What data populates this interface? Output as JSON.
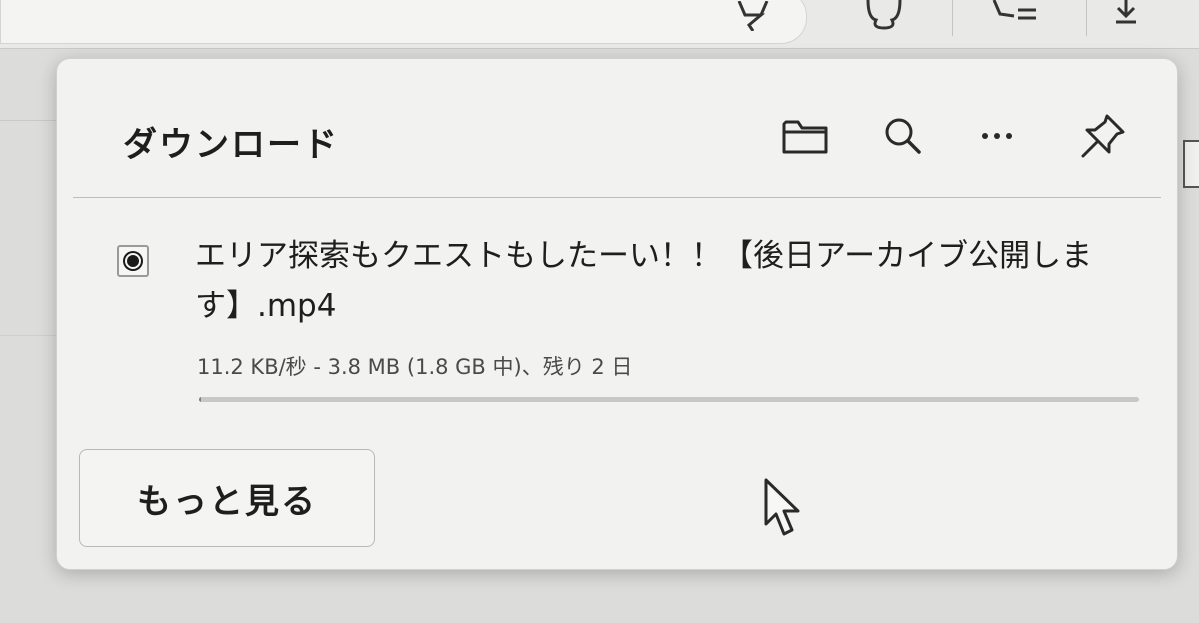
{
  "flyout": {
    "title": "ダウンロード",
    "header_icons": [
      "folder-icon",
      "search-icon",
      "more-options-icon",
      "pin-icon"
    ],
    "more_button_label": "もっと見る"
  },
  "download_item": {
    "file_name": "エリア探索もクエストもしたーい！！【後日アーカイブ公開します】.mp4",
    "status": "11.2 KB/秒 - 3.8 MB (1.8 GB 中)、残り 2 日",
    "progress": 0.002
  },
  "toolbar": {
    "icons": [
      "favorite-star-icon",
      "extensions-icon",
      "favorites-list-icon",
      "downloads-icon"
    ]
  }
}
